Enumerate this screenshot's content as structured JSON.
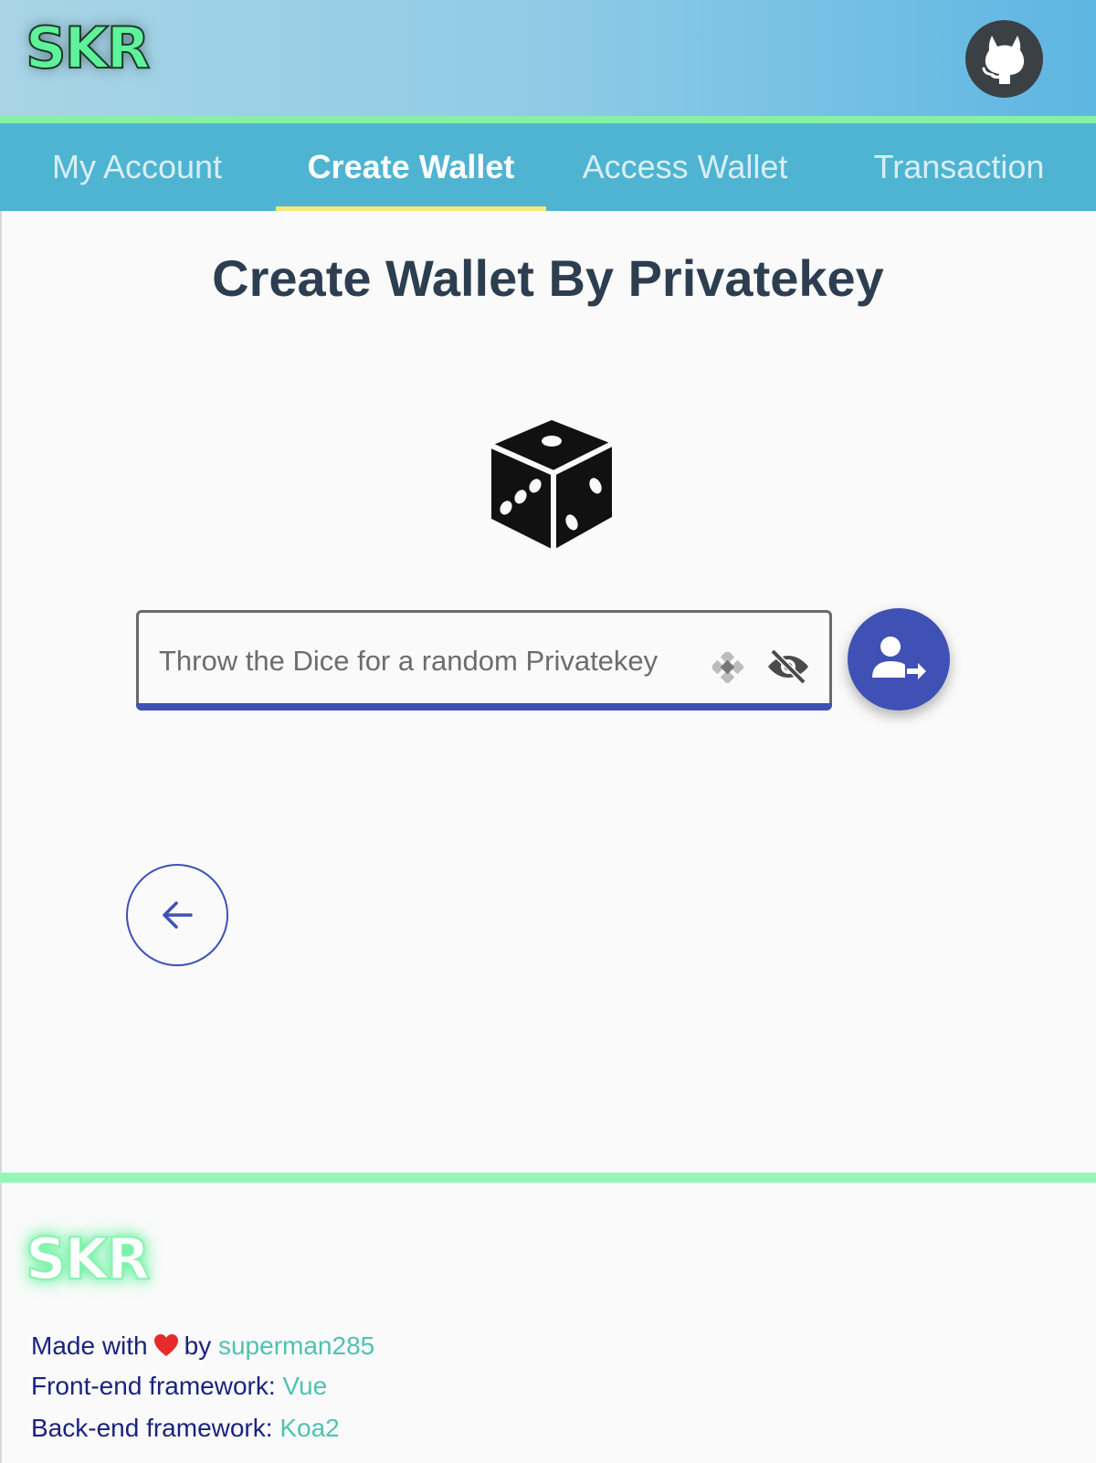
{
  "header": {
    "logo_text": "SKR",
    "github_icon": "github-icon"
  },
  "tabs": [
    {
      "label": "My Account",
      "active": false
    },
    {
      "label": "Create Wallet",
      "active": true
    },
    {
      "label": "Access Wallet",
      "active": false
    },
    {
      "label": "Transaction",
      "active": false
    }
  ],
  "main": {
    "title": "Create Wallet By Privatekey",
    "dice_icon": "dice-icon",
    "input": {
      "placeholder": "Throw the Dice for a random Privatekey",
      "value": ""
    },
    "clear_icon": "clear-icon",
    "visibility_icon": "eye-off-icon",
    "submit_icon": "account-arrow-right-icon",
    "back_icon": "arrow-left-icon"
  },
  "footer": {
    "logo_text": "SKR",
    "made_with_prefix": "Made with",
    "made_with_by": "by",
    "author": "superman285",
    "frontend_label": "Front-end framework:",
    "frontend_value": "Vue",
    "backend_label": "Back-end framework:",
    "backend_value": "Koa2"
  },
  "colors": {
    "accent": "#3f51b5",
    "tabs_bg": "#4fb4d2",
    "logo_green": "#5ff29a",
    "link_teal": "#4fc3b1",
    "active_tab_underline": "#f5e87a"
  }
}
